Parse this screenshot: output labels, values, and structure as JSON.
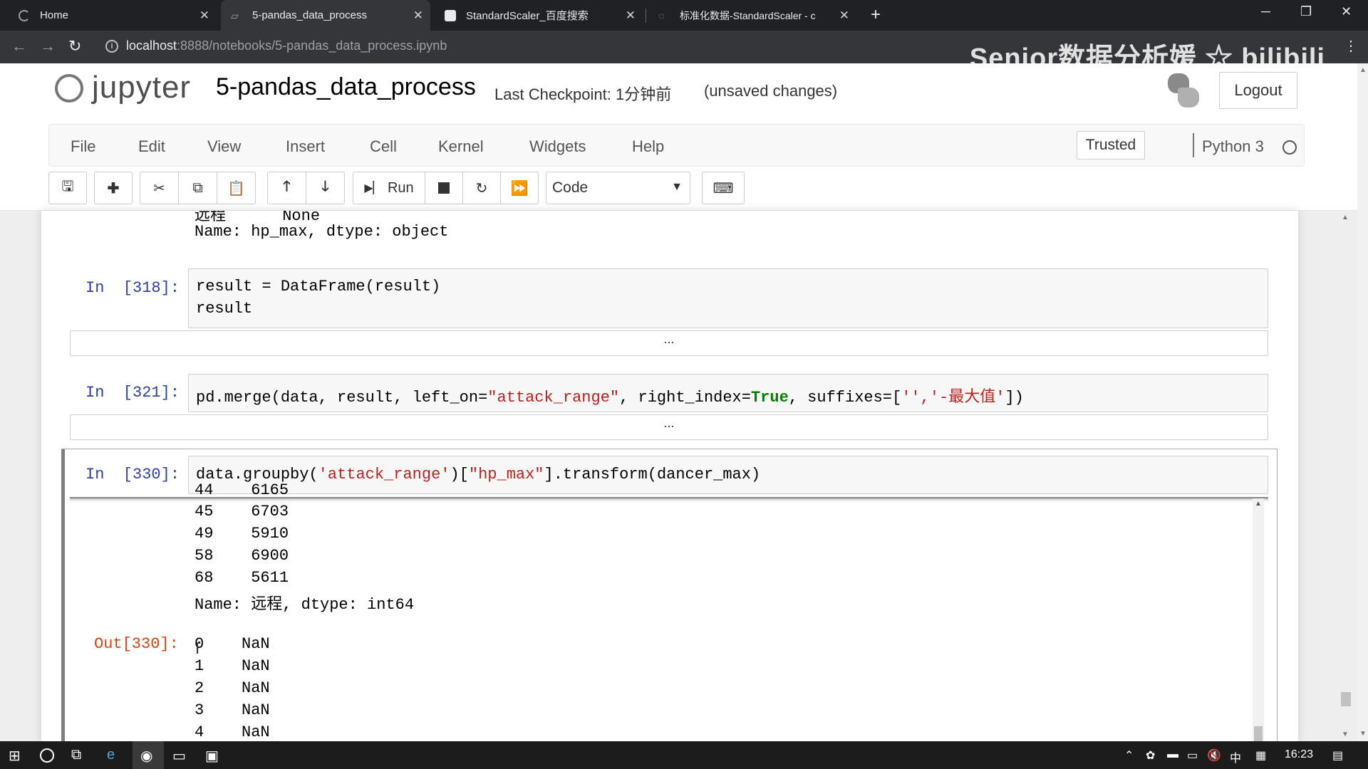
{
  "browser": {
    "tabs": [
      {
        "title": "Home"
      },
      {
        "title": "5-pandas_data_process"
      },
      {
        "title": "StandardScaler_百度搜索"
      },
      {
        "title": "标准化数据-StandardScaler - c"
      }
    ],
    "url_host": "localhost",
    "url_path": ":8888/notebooks/5-pandas_data_process.ipynb",
    "watermark": "Senior数据分析媛 ☆ bilibili"
  },
  "jupyter": {
    "logo_text": "jupyter",
    "notebook_title": "5-pandas_data_process",
    "checkpoint": "Last Checkpoint: 1分钟前",
    "unsaved": "(unsaved changes)",
    "logout_label": "Logout",
    "menu": [
      "File",
      "Edit",
      "View",
      "Insert",
      "Cell",
      "Kernel",
      "Widgets",
      "Help"
    ],
    "trusted_label": "Trusted",
    "kernel_name": "Python 3",
    "toolbar": {
      "run_label": "Run",
      "cell_type": "Code"
    }
  },
  "notebook": {
    "prev_output": {
      "line1": "远程      None",
      "line2": "Name: hp_max, dtype: object"
    },
    "cell318": {
      "prompt": "In  [318]:",
      "line1": "result = DataFrame(result)",
      "line2": "result",
      "collapsed": "..."
    },
    "cell321": {
      "prompt": "In  [321]:",
      "code_a": "pd.merge(data, result, left_on=",
      "code_str1": "\"attack_range\"",
      "code_b": ", right_index=",
      "code_kw": "True",
      "code_c": ", suffixes=[",
      "code_str2": "'','-最大值'",
      "code_d": "])",
      "collapsed": "..."
    },
    "cell330": {
      "prompt": "In  [330]:",
      "code_a": "data.groupby(",
      "code_str1": "'attack_range'",
      "code_b": ")[",
      "code_str2": "\"hp_max\"",
      "code_c": "].transform(dancer_max)",
      "stdout_rows": [
        [
          "44",
          "6165"
        ],
        [
          "45",
          "6703"
        ],
        [
          "49",
          "5910"
        ],
        [
          "58",
          "6900"
        ],
        [
          "68",
          "5611"
        ]
      ],
      "stdout_footer": "Name: 远程, dtype: int64",
      "out_prompt": "Out[330]:",
      "out_rows": [
        [
          "0",
          "NaN"
        ],
        [
          "1",
          "NaN"
        ],
        [
          "2",
          "NaN"
        ],
        [
          "3",
          "NaN"
        ],
        [
          "4",
          "NaN"
        ]
      ]
    }
  },
  "taskbar": {
    "ime": "中",
    "time": "16:23"
  }
}
